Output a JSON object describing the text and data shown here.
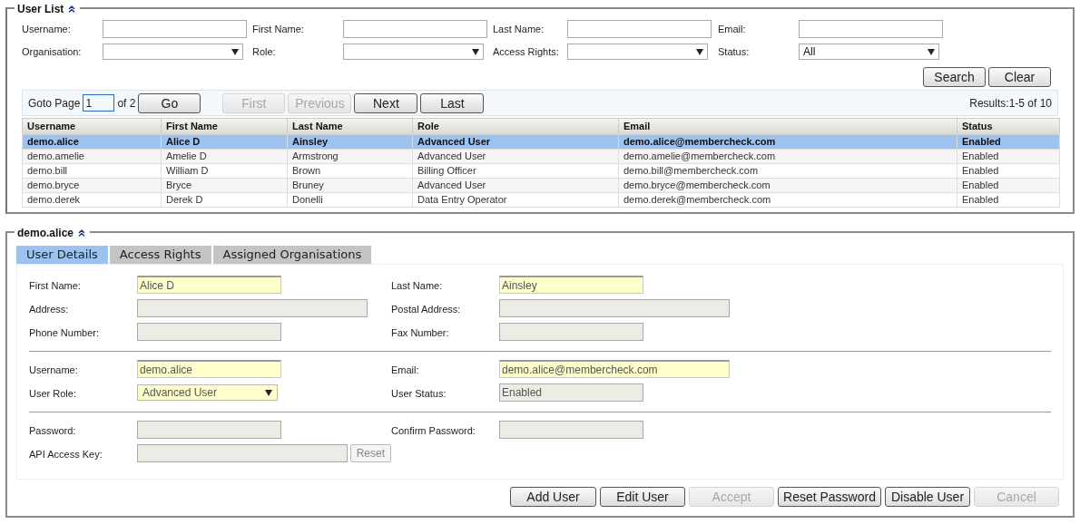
{
  "user_list": {
    "title": "User List",
    "filters": [
      {
        "label": "Username:",
        "kind": "text"
      },
      {
        "label": "First Name:",
        "kind": "text"
      },
      {
        "label": "Last Name:",
        "kind": "text"
      },
      {
        "label": "Email:",
        "kind": "text"
      },
      {
        "label": "Organisation:",
        "kind": "select"
      },
      {
        "label": "Role:",
        "kind": "select"
      },
      {
        "label": "Access Rights:",
        "kind": "select"
      },
      {
        "label": "Status:",
        "kind": "select",
        "value": "All"
      }
    ],
    "actions": [
      {
        "label": "Search",
        "disabled": false
      },
      {
        "label": "Clear",
        "disabled": false
      }
    ],
    "pager": {
      "goto_label": "Goto Page",
      "page": "1",
      "of": "of 2",
      "go": "Go",
      "buttons": [
        {
          "label": "First",
          "disabled": true
        },
        {
          "label": "Previous",
          "disabled": true
        },
        {
          "label": "Next",
          "disabled": false
        },
        {
          "label": "Last",
          "disabled": false
        }
      ],
      "results": "Results:1-5 of 10"
    },
    "table": {
      "columns": [
        "Username",
        "First Name",
        "Last Name",
        "Role",
        "Email",
        "Status"
      ],
      "rows": [
        {
          "cells": [
            "demo.alice",
            "Alice D",
            "Ainsley",
            "Advanced User",
            "demo.alice@membercheck.com",
            "Enabled"
          ],
          "selected": true
        },
        {
          "cells": [
            "demo.amelie",
            "Amelie D",
            "Armstrong",
            "Advanced User",
            "demo.amelie@membercheck.com",
            "Enabled"
          ],
          "selected": false
        },
        {
          "cells": [
            "demo.bill",
            "William D",
            "Brown",
            "Billing Officer",
            "demo.bill@membercheck.com",
            "Enabled"
          ],
          "selected": false
        },
        {
          "cells": [
            "demo.bryce",
            "Bryce",
            "Bruney",
            "Advanced User",
            "demo.bryce@membercheck.com",
            "Enabled"
          ],
          "selected": false
        },
        {
          "cells": [
            "demo.derek",
            "Derek D",
            "Donelli",
            "Data Entry Operator",
            "demo.derek@membercheck.com",
            "Enabled"
          ],
          "selected": false
        }
      ]
    }
  },
  "detail": {
    "title": "demo.alice",
    "tabs": [
      {
        "label": "User Details",
        "selected": true
      },
      {
        "label": "Access Rights",
        "selected": false
      },
      {
        "label": "Assigned Organisations",
        "selected": false
      }
    ],
    "sections": [
      [
        {
          "left": {
            "label": "First Name:",
            "kind": "text",
            "value": "Alice D",
            "required": true
          },
          "right": {
            "label": "Last Name:",
            "kind": "text",
            "value": "Ainsley",
            "required": true
          }
        },
        {
          "left": {
            "label": "Address:",
            "kind": "long_text",
            "required": false
          },
          "right": {
            "label": "Postal Address:",
            "kind": "long_text",
            "required": false
          }
        },
        {
          "left": {
            "label": "Phone Number:",
            "kind": "text",
            "required": false
          },
          "right": {
            "label": "Fax Number:",
            "kind": "text",
            "required": false
          }
        }
      ],
      [
        {
          "left": {
            "label": "Username:",
            "kind": "text",
            "value": "demo.alice",
            "required": true
          },
          "right": {
            "label": "Email:",
            "kind": "long_text",
            "value": "demo.alice@membercheck.com",
            "required": true
          }
        },
        {
          "left": {
            "label": "User Role:",
            "kind": "select",
            "value": "Advanced User",
            "required": true
          },
          "right": {
            "label": "User Status:",
            "kind": "text",
            "value": "Enabled",
            "required": false
          }
        }
      ],
      [
        {
          "left": {
            "label": "Password:",
            "kind": "text",
            "required": false
          },
          "right": {
            "label": "Confirm Password:",
            "kind": "text",
            "required": false
          }
        },
        {
          "left": {
            "label": "API Access Key:",
            "kind": "key",
            "required": false,
            "button": "Reset"
          }
        }
      ]
    ],
    "actions": [
      {
        "label": "Add User",
        "disabled": false
      },
      {
        "label": "Edit User",
        "disabled": false
      },
      {
        "label": "Accept",
        "disabled": true
      },
      {
        "label": "Reset Password",
        "disabled": false
      },
      {
        "label": "Disable User",
        "disabled": false
      },
      {
        "label": "Cancel",
        "disabled": true
      }
    ]
  }
}
